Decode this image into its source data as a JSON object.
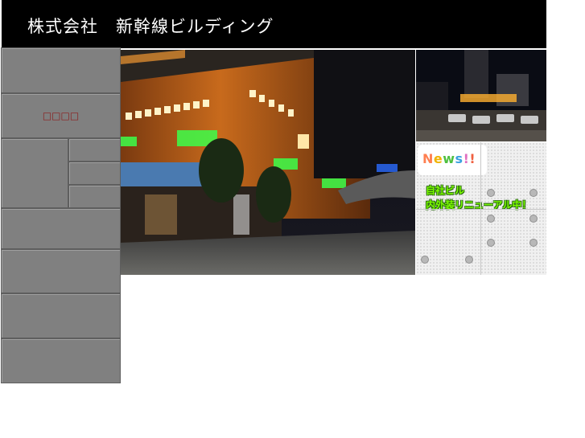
{
  "header": {
    "company": "株式会社　新幹線ビルディング"
  },
  "nav": {
    "items": [
      {
        "label": ""
      },
      {
        "label": "□□□□"
      },
      {
        "label": ""
      },
      {
        "label": ""
      },
      {
        "label": ""
      },
      {
        "label": ""
      },
      {
        "label": ""
      },
      {
        "label": ""
      },
      {
        "label": ""
      },
      {
        "label": ""
      }
    ]
  },
  "news": {
    "title_chars": [
      "N",
      "e",
      "w",
      "s",
      "!",
      "!"
    ],
    "line1": "自社ビル",
    "line2": "内外装リニューアル中！"
  },
  "colors": {
    "header_bg": "#000000",
    "nav_bg": "#808080",
    "nav_label": "#8b1a1a",
    "news_text_green": "#7CFC00"
  },
  "icons": {
    "building_photo": "night-building-photo",
    "station_photo": "station-plaza-photo"
  }
}
